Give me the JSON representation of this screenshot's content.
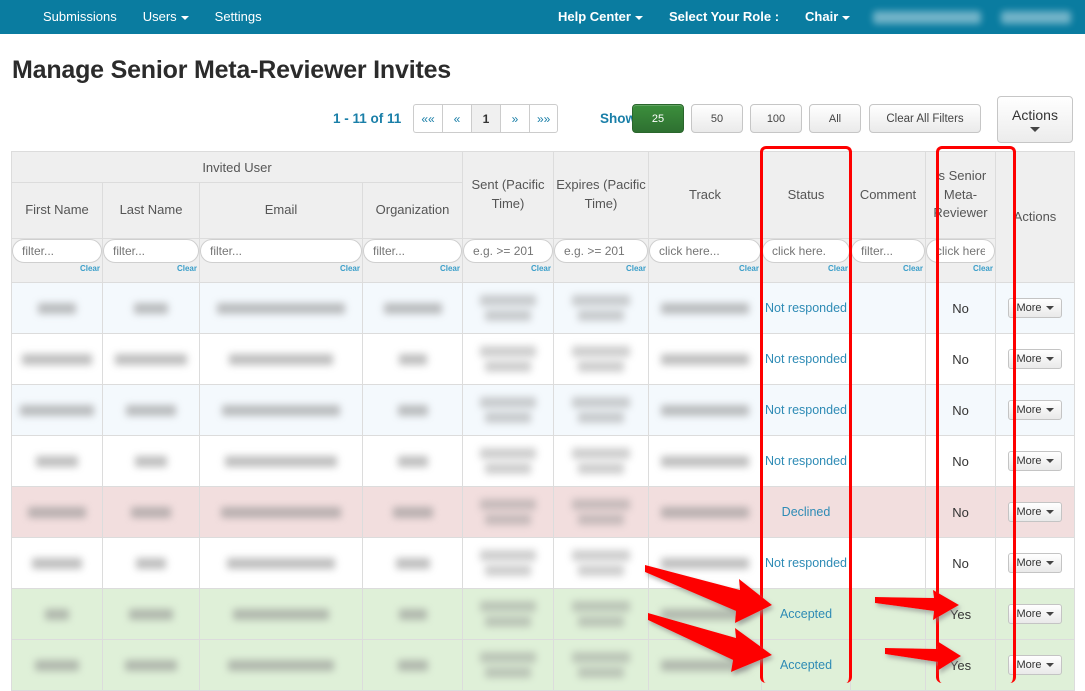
{
  "navbar": {
    "left_items": [
      {
        "label": "Submissions",
        "caret": false
      },
      {
        "label": "Users",
        "caret": true
      },
      {
        "label": "Settings",
        "caret": false
      }
    ],
    "right_items": [
      {
        "label": "Help Center",
        "caret": true,
        "bold": true
      },
      {
        "label": "Select Your Role :",
        "caret": false,
        "bold": true
      },
      {
        "label": "Chair",
        "caret": true,
        "bold": true
      }
    ],
    "redacted_items": [
      "redacted-conference-name",
      "redacted-user-name"
    ],
    "background_color": "#0a7ca0"
  },
  "page": {
    "title": "Manage Senior Meta-Reviewer Invites"
  },
  "toolbar": {
    "record_count": "1 - 11 of 11",
    "pager": [
      {
        "label": "««",
        "active": false
      },
      {
        "label": "«",
        "active": false
      },
      {
        "label": "1",
        "active": true
      },
      {
        "label": "»",
        "active": false
      },
      {
        "label": "»»",
        "active": false
      }
    ],
    "show_label": "Show:",
    "show_options": [
      {
        "label": "25",
        "selected": true
      },
      {
        "label": "50",
        "selected": false
      },
      {
        "label": "100",
        "selected": false
      },
      {
        "label": "All",
        "selected": false
      }
    ],
    "clear_all_filters_label": "Clear All Filters",
    "actions_label": "Actions",
    "selected_page_size_color": "#2e7031"
  },
  "table": {
    "group_header": "Invited User",
    "columns": [
      {
        "key": "first_name",
        "label": "First Name",
        "filter_placeholder": "filter...",
        "clear_label": "Clear"
      },
      {
        "key": "last_name",
        "label": "Last Name",
        "filter_placeholder": "filter...",
        "clear_label": "Clear"
      },
      {
        "key": "email",
        "label": "Email",
        "filter_placeholder": "filter...",
        "clear_label": "Clear"
      },
      {
        "key": "organization",
        "label": "Organization",
        "filter_placeholder": "filter...",
        "clear_label": "Clear"
      },
      {
        "key": "sent",
        "label": "Sent (Pacific Time)",
        "filter_placeholder": "e.g. >= 201",
        "clear_label": "Clear"
      },
      {
        "key": "expires",
        "label": "Expires (Pacific Time)",
        "filter_placeholder": "e.g. >= 201",
        "clear_label": "Clear"
      },
      {
        "key": "track",
        "label": "Track",
        "filter_placeholder": "click here...",
        "clear_label": "Clear"
      },
      {
        "key": "status",
        "label": "Status",
        "filter_placeholder": "click here.",
        "clear_label": "Clear"
      },
      {
        "key": "comment",
        "label": "Comment",
        "filter_placeholder": "filter...",
        "clear_label": "Clear"
      },
      {
        "key": "is_senior_meta_reviewer",
        "label": "Is Senior Meta-Reviewer",
        "filter_placeholder": "click here",
        "clear_label": "Clear"
      },
      {
        "key": "actions",
        "label": "Actions",
        "filter_placeholder": "",
        "clear_label": ""
      }
    ],
    "row_action_label": "More",
    "rows": [
      {
        "redacted": true,
        "status": "Not responded",
        "comment": "",
        "is_senior": "No",
        "row_style": "row-odd"
      },
      {
        "redacted": true,
        "status": "Not responded",
        "comment": "",
        "is_senior": "No",
        "row_style": "row-even"
      },
      {
        "redacted": true,
        "status": "Not responded",
        "comment": "",
        "is_senior": "No",
        "row_style": "row-odd"
      },
      {
        "redacted": true,
        "status": "Not responded",
        "comment": "",
        "is_senior": "No",
        "row_style": "row-even"
      },
      {
        "redacted": true,
        "status": "Declined",
        "comment": "",
        "is_senior": "No",
        "row_style": "row-declined"
      },
      {
        "redacted": true,
        "status": "Not responded",
        "comment": "",
        "is_senior": "No",
        "row_style": "row-even"
      },
      {
        "redacted": true,
        "status": "Accepted",
        "comment": "",
        "is_senior": "Yes",
        "row_style": "row-accepted"
      },
      {
        "redacted": true,
        "status": "Accepted",
        "comment": "",
        "is_senior": "Yes",
        "row_style": "row-accepted"
      }
    ]
  },
  "annotations": {
    "highlight_color": "#fe0000",
    "boxes": [
      {
        "name": "status-column-highlight"
      },
      {
        "name": "is-senior-meta-reviewer-column-highlight"
      }
    ],
    "arrows": [
      {
        "name": "arrow-to-accepted-row-1"
      },
      {
        "name": "arrow-to-accepted-row-2"
      },
      {
        "name": "arrow-to-yes-row-1"
      },
      {
        "name": "arrow-to-yes-row-2"
      }
    ]
  }
}
